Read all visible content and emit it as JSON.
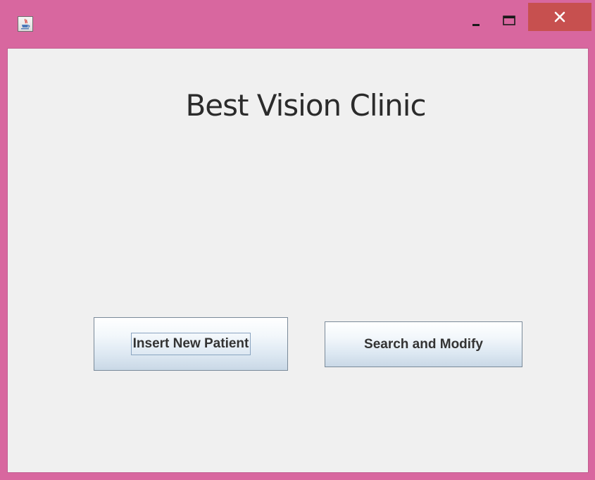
{
  "window": {
    "title": "",
    "icon": "java-cup-icon",
    "controls": {
      "minimize": "minimize-icon",
      "maximize": "maximize-icon",
      "close": "close-icon"
    },
    "frame_color": "#d8679f",
    "close_color": "#c7504f"
  },
  "main": {
    "title": "Best Vision Clinic",
    "buttons": {
      "insert_label": "Insert New Patient",
      "search_label": "Search and Modify"
    }
  }
}
